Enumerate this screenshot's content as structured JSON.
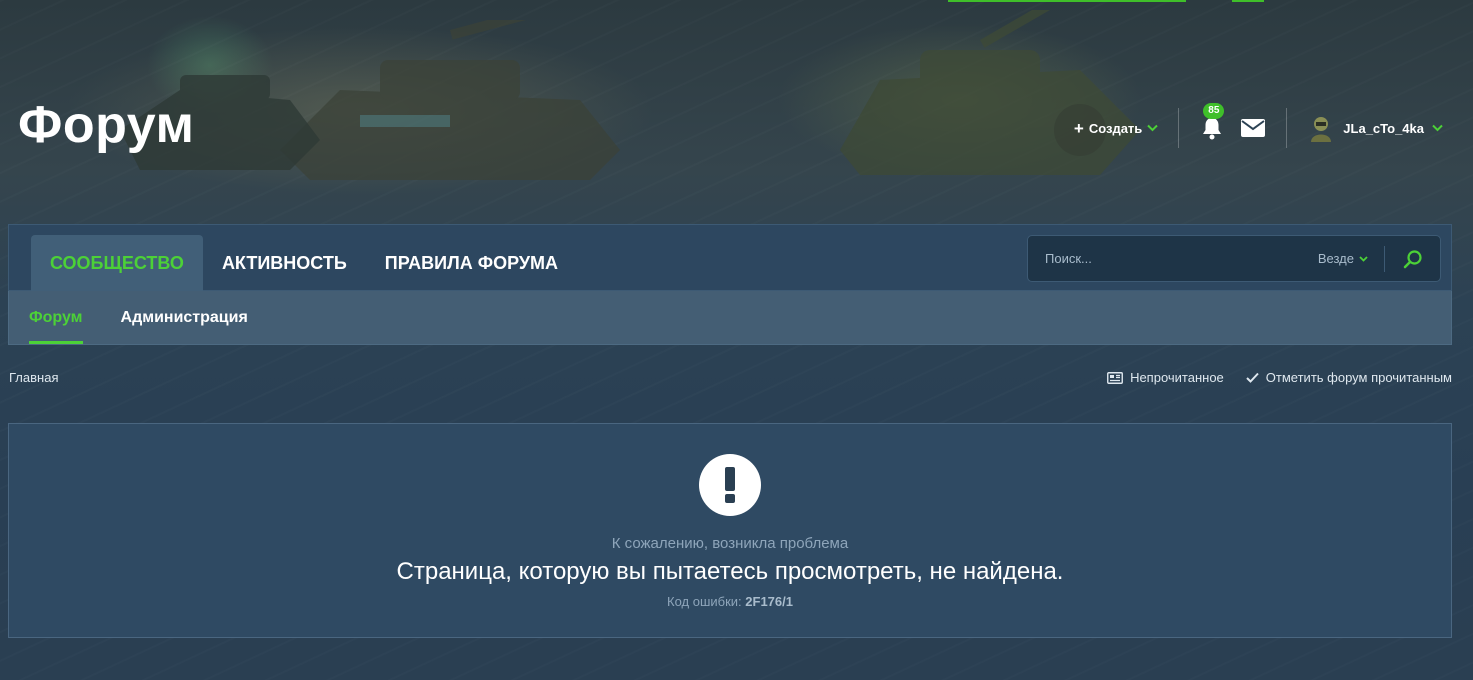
{
  "header": {
    "site_title": "Форум",
    "create_label": "Создать",
    "notification_count": "85",
    "username": "JLa_cTo_4ka"
  },
  "nav": {
    "tabs": [
      {
        "label": "Сообщество",
        "active": true
      },
      {
        "label": "Активность",
        "active": false
      },
      {
        "label": "Правила форума",
        "active": false
      }
    ]
  },
  "search": {
    "placeholder": "Поиск...",
    "scope": "Везде"
  },
  "subnav": {
    "items": [
      {
        "label": "Форум",
        "active": true
      },
      {
        "label": "Администрация",
        "active": false
      }
    ]
  },
  "breadcrumb": {
    "home": "Главная"
  },
  "actions": {
    "unread": "Непрочитанное",
    "mark_read": "Отметить форум прочитанным"
  },
  "error": {
    "subtitle": "К сожалению, возникла проблема",
    "message": "Страница, которую вы пытаетесь просмотреть, не найдена.",
    "code_label": "Код ошибки:",
    "code": "2F176/1"
  },
  "colors": {
    "accent": "#4cd137",
    "nav_bg": "#2d4760",
    "subnav_bg": "#445e74",
    "box_bg": "#2f4a63"
  },
  "icons": [
    "plus-icon",
    "chevron-down-icon",
    "bell-icon",
    "envelope-icon",
    "search-icon",
    "newspaper-icon",
    "check-icon",
    "exclamation-icon"
  ]
}
